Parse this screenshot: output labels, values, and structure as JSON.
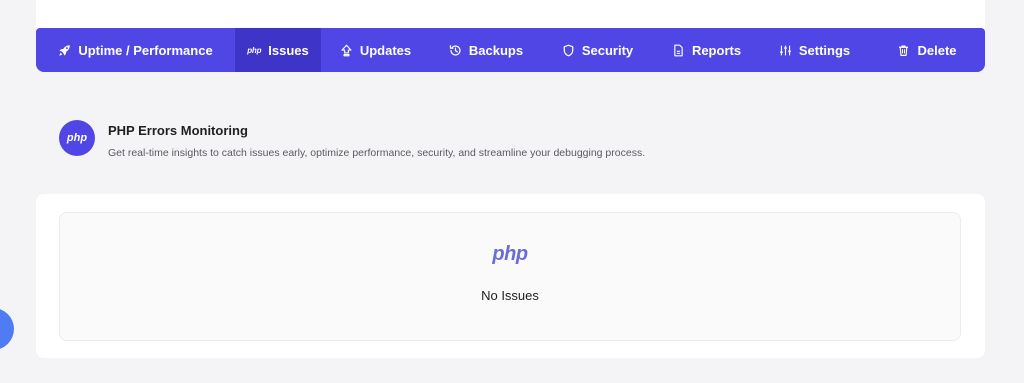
{
  "nav": {
    "tabs": [
      {
        "label": "Uptime / Performance",
        "icon": "rocket-icon",
        "active": false
      },
      {
        "label": "Issues",
        "icon": "php-icon",
        "icon_text": "php",
        "active": true
      },
      {
        "label": "Updates",
        "icon": "upload-arrow-icon",
        "active": false
      },
      {
        "label": "Backups",
        "icon": "history-icon",
        "active": false
      },
      {
        "label": "Security",
        "icon": "shield-icon",
        "active": false
      },
      {
        "label": "Reports",
        "icon": "document-icon",
        "active": false
      },
      {
        "label": "Settings",
        "icon": "sliders-icon",
        "active": false
      },
      {
        "label": "Delete",
        "icon": "trash-icon",
        "active": false
      }
    ]
  },
  "section": {
    "icon_text": "php",
    "title": "PHP Errors Monitoring",
    "description": "Get real-time insights to catch issues early, optimize performance, security, and streamline your debugging process."
  },
  "empty_state": {
    "logo_text": "php",
    "message": "No Issues"
  },
  "colors": {
    "accent": "#5046e5",
    "accent_active": "#3e34c8",
    "fab": "#4f7cf4",
    "php_logo": "#6c6cd6"
  }
}
